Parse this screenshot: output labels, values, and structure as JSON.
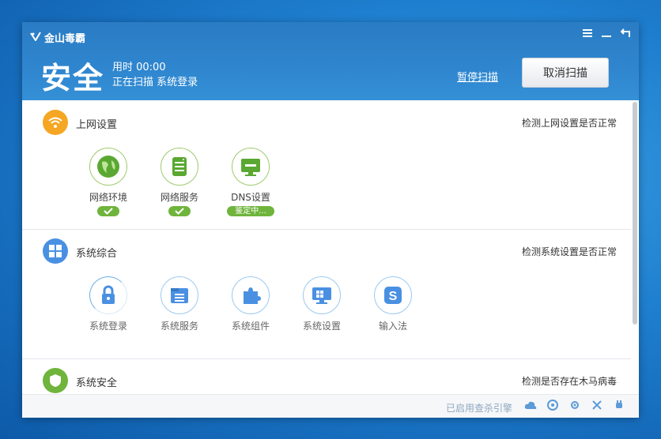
{
  "app": {
    "logo_text": "金山毒霸"
  },
  "header": {
    "title": "安全",
    "time_label": "用时 00:00",
    "status": "正在扫描  系统登录",
    "pause_link": "暂停扫描",
    "cancel_button": "取消扫描"
  },
  "window_controls": {
    "menu": "☰",
    "minimize": "—",
    "restore": "⮌"
  },
  "sections": [
    {
      "title": "上网设置",
      "description": "检测上网设置是否正常",
      "icon": "wifi-icon",
      "color": "#f5a623",
      "items": [
        {
          "label": "网络环境",
          "icon": "globe-icon",
          "status": "done"
        },
        {
          "label": "网络服务",
          "icon": "server-icon",
          "status": "done"
        },
        {
          "label": "DNS设置",
          "icon": "monitor-icon",
          "status": "鉴定中..."
        }
      ]
    },
    {
      "title": "系统综合",
      "description": "检测系统设置是否正常",
      "icon": "windows-icon",
      "color": "#4a90e2",
      "items": [
        {
          "label": "系统登录",
          "icon": "lock-icon"
        },
        {
          "label": "系统服务",
          "icon": "folder-icon"
        },
        {
          "label": "系统组件",
          "icon": "puzzle-icon"
        },
        {
          "label": "系统设置",
          "icon": "monitor-settings-icon"
        },
        {
          "label": "输入法",
          "icon": "ime-icon"
        }
      ]
    },
    {
      "title": "系统安全",
      "description": "检测是否存在木马病毒",
      "icon": "shield-icon",
      "color": "#6fb43c"
    }
  ],
  "footer": {
    "engine_text": "已启用查杀引擎"
  }
}
